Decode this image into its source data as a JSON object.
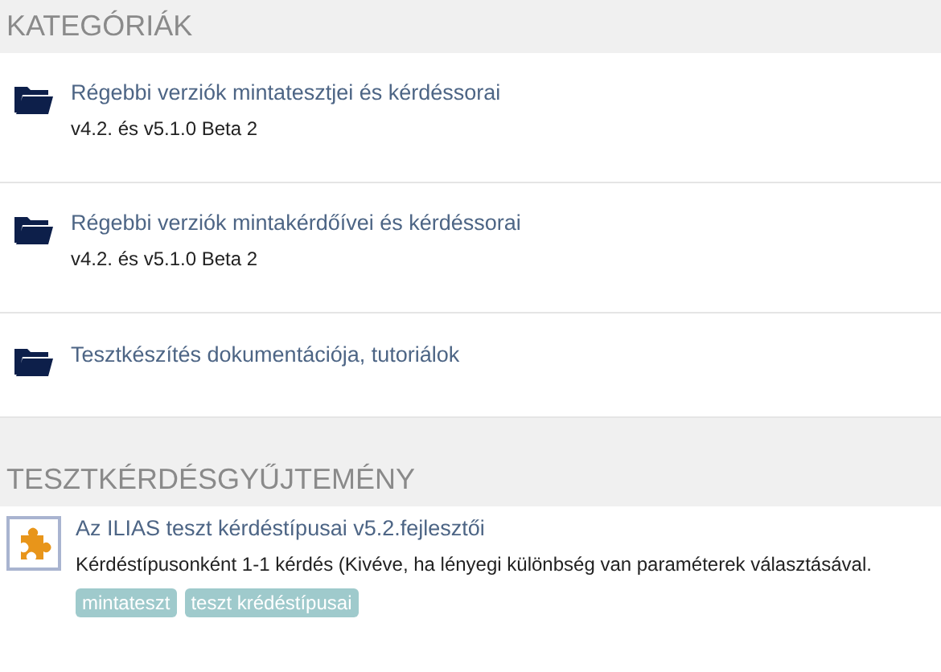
{
  "categories": {
    "title": "KATEGÓRIÁK",
    "items": [
      {
        "title": "Régebbi verziók mintatesztjei és kérdéssorai",
        "description": "v4.2. és v5.1.0 Beta 2"
      },
      {
        "title": "Régebbi verziók mintakérdőívei és kérdéssorai",
        "description": "v4.2. és v5.1.0 Beta 2"
      },
      {
        "title": "Tesztkészítés dokumentációja, tutoriálok"
      }
    ]
  },
  "pools": {
    "title": "TESZTKÉRDÉSGYŰJTEMÉNY",
    "items": [
      {
        "title": "Az ILIAS teszt kérdéstípusai v5.2.fejlesztői",
        "description": "Kérdéstípusonként 1-1 kérdés (Kivéve, ha lényegi különbség van paraméterek választásával.",
        "tags": [
          "mintateszt",
          "teszt krédéstípusai"
        ]
      }
    ]
  }
}
